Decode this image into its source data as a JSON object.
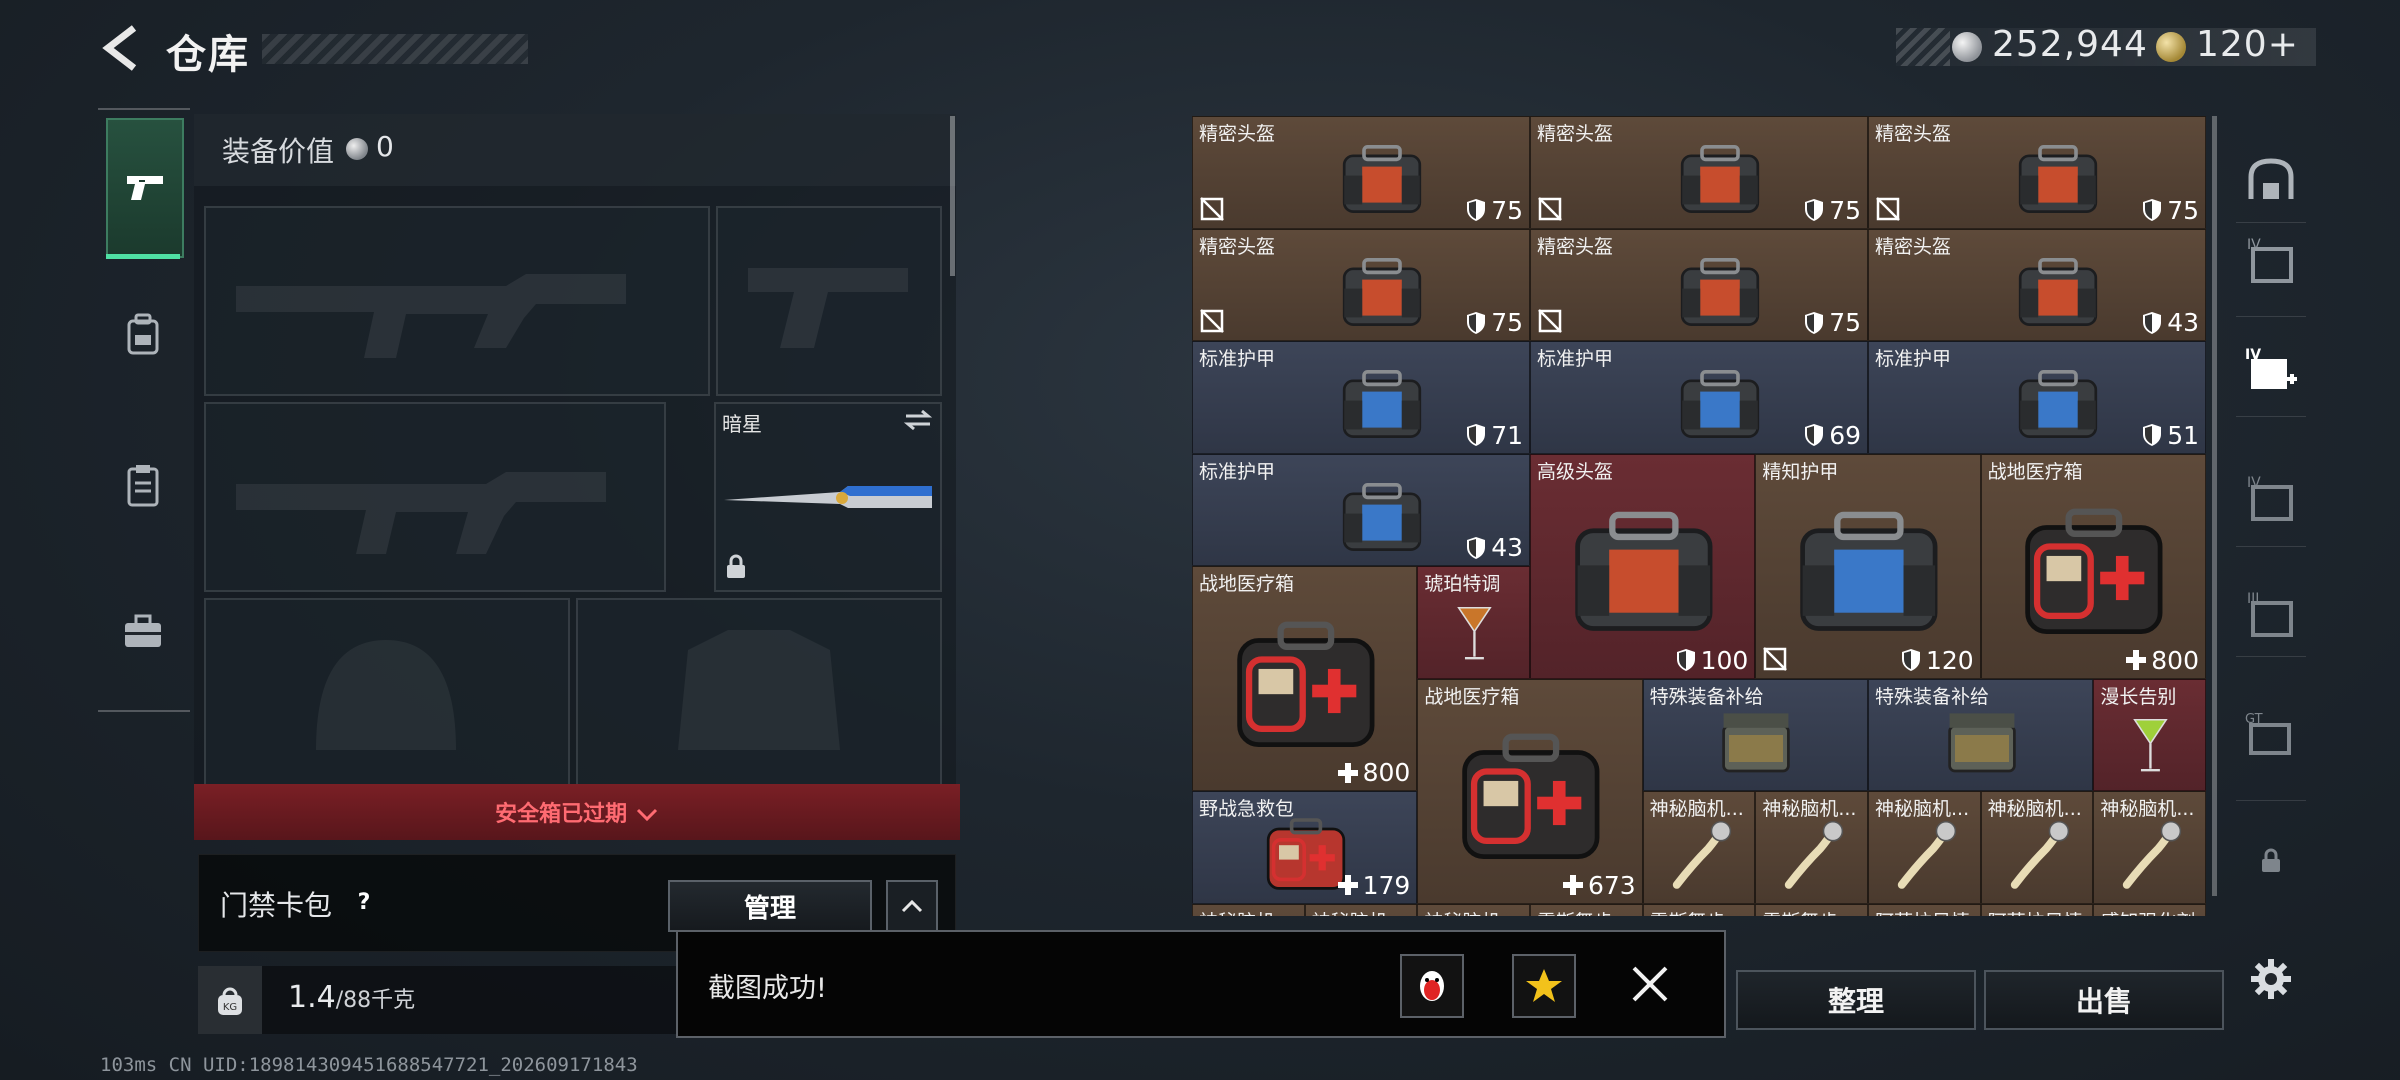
{
  "header": {
    "title": "仓库",
    "currency_silver": "252,944",
    "currency_gold": "120+"
  },
  "categories": [
    "firearm-icon",
    "backpack-icon",
    "clipboard-icon",
    "toolbox-icon"
  ],
  "loadout": {
    "title": "装备价值",
    "value": "0",
    "knife_name": "暗星",
    "expired_text": "安全箱已过期",
    "card_label": "门禁卡包",
    "help": "?",
    "manage_label": "管理",
    "weight_value": "1.4",
    "weight_max": "/88千克"
  },
  "inventory": {
    "items": [
      {
        "name": "精密头盔",
        "value": "75",
        "icon": "shield-icon",
        "quality": "brown",
        "item": "helmet-bag",
        "broken": true
      },
      {
        "name": "精密头盔",
        "value": "75",
        "icon": "shield-icon",
        "quality": "brown",
        "item": "helmet-bag",
        "broken": true
      },
      {
        "name": "精密头盔",
        "value": "75",
        "icon": "shield-icon",
        "quality": "brown",
        "item": "helmet-bag",
        "broken": true
      },
      {
        "name": "精密头盔",
        "value": "75",
        "icon": "shield-icon",
        "quality": "brown",
        "item": "helmet-bag",
        "broken": true
      },
      {
        "name": "精密头盔",
        "value": "75",
        "icon": "shield-icon",
        "quality": "brown",
        "item": "helmet-bag",
        "broken": true
      },
      {
        "name": "精密头盔",
        "value": "43",
        "icon": "shield-icon",
        "quality": "brown",
        "item": "helmet-bag",
        "broken": false
      },
      {
        "name": "标准护甲",
        "value": "71",
        "icon": "shield-icon",
        "quality": "blue",
        "item": "armor-bag",
        "broken": false
      },
      {
        "name": "标准护甲",
        "value": "69",
        "icon": "shield-icon",
        "quality": "blue",
        "item": "armor-bag",
        "broken": false
      },
      {
        "name": "标准护甲",
        "value": "51",
        "icon": "shield-icon",
        "quality": "blue",
        "item": "armor-bag",
        "broken": false
      },
      {
        "name": "标准护甲",
        "value": "43",
        "icon": "shield-icon",
        "quality": "blue",
        "item": "armor-bag",
        "broken": false
      },
      {
        "name": "高级头盔",
        "value": "100",
        "icon": "shield-icon",
        "quality": "red",
        "item": "helmet-bag-large",
        "broken": false
      },
      {
        "name": "精知护甲",
        "value": "120",
        "icon": "shield-icon",
        "quality": "brown",
        "item": "armor-bag-large",
        "broken": true
      },
      {
        "name": "战地医疗箱",
        "value": "800",
        "icon": "plus-icon",
        "quality": "brown",
        "item": "medkit",
        "broken": false
      },
      {
        "name": "战地医疗箱",
        "value": "800",
        "icon": "plus-icon",
        "quality": "brown",
        "item": "medkit",
        "broken": false
      },
      {
        "name": "琥珀特调",
        "value": "",
        "icon": "",
        "quality": "red",
        "item": "cocktail",
        "broken": false
      },
      {
        "name": "战地医疗箱",
        "value": "673",
        "icon": "plus-icon",
        "quality": "brown",
        "item": "medkit",
        "broken": false
      },
      {
        "name": "特殊装备补给",
        "value": "",
        "icon": "",
        "quality": "blue",
        "item": "supply-case",
        "broken": false
      },
      {
        "name": "特殊装备补给",
        "value": "",
        "icon": "",
        "quality": "blue",
        "item": "supply-case",
        "broken": false
      },
      {
        "name": "漫长告别",
        "value": "",
        "icon": "",
        "quality": "red",
        "item": "cocktail-green",
        "broken": false
      },
      {
        "name": "野战急救包",
        "value": "179",
        "icon": "plus-icon",
        "quality": "blue",
        "item": "first-aid",
        "broken": false
      },
      {
        "name": "神秘脑机...",
        "value": "",
        "icon": "",
        "quality": "brown",
        "item": "brain-chip",
        "broken": false
      },
      {
        "name": "神秘脑机...",
        "value": "",
        "icon": "",
        "quality": "brown",
        "item": "brain-chip",
        "broken": false
      },
      {
        "name": "神秘脑机...",
        "value": "",
        "icon": "",
        "quality": "brown",
        "item": "brain-chip",
        "broken": false
      },
      {
        "name": "神秘脑机...",
        "value": "",
        "icon": "",
        "quality": "brown",
        "item": "brain-chip",
        "broken": false
      },
      {
        "name": "神秘脑机...",
        "value": "",
        "icon": "",
        "quality": "brown",
        "item": "brain-chip",
        "broken": false
      },
      {
        "name": "神秘脑机...",
        "value": "",
        "icon": "",
        "quality": "brown",
        "item": "brain-chip",
        "broken": false
      },
      {
        "name": "神秘脑机...",
        "value": "",
        "icon": "",
        "quality": "brown",
        "item": "brain-chip",
        "broken": false
      },
      {
        "name": "神秘脑机...",
        "value": "",
        "icon": "",
        "quality": "brown",
        "item": "brain-chip",
        "broken": false
      },
      {
        "name": "雷斯舞步",
        "value": "",
        "icon": "",
        "quality": "brown",
        "item": "misc",
        "broken": false
      },
      {
        "name": "雷斯舞步",
        "value": "",
        "icon": "",
        "quality": "brown",
        "item": "misc",
        "broken": false
      },
      {
        "name": "雷斯舞步",
        "value": "",
        "icon": "",
        "quality": "brown",
        "item": "misc",
        "broken": false
      },
      {
        "name": "阿萨拉风情",
        "value": "",
        "icon": "",
        "quality": "brown",
        "item": "misc",
        "broken": false
      },
      {
        "name": "阿萨拉风情",
        "value": "",
        "icon": "",
        "quality": "brown",
        "item": "misc",
        "broken": false
      },
      {
        "name": "感知强化剂",
        "value": "",
        "icon": "",
        "quality": "brown",
        "item": "misc",
        "broken": false
      }
    ]
  },
  "actions": {
    "sort_label": "整理",
    "sell_label": "出售"
  },
  "toast": {
    "message": "截图成功!"
  },
  "status": {
    "line": "103ms   CN UID:1898143094516885477​21_202609171843"
  },
  "colors": {
    "accent_green": "#4fe0a4",
    "expired_red": "#ff6b72",
    "quality_brown": "#5e4a3a",
    "quality_blue": "#3d4558",
    "quality_red": "#6a2d33"
  }
}
